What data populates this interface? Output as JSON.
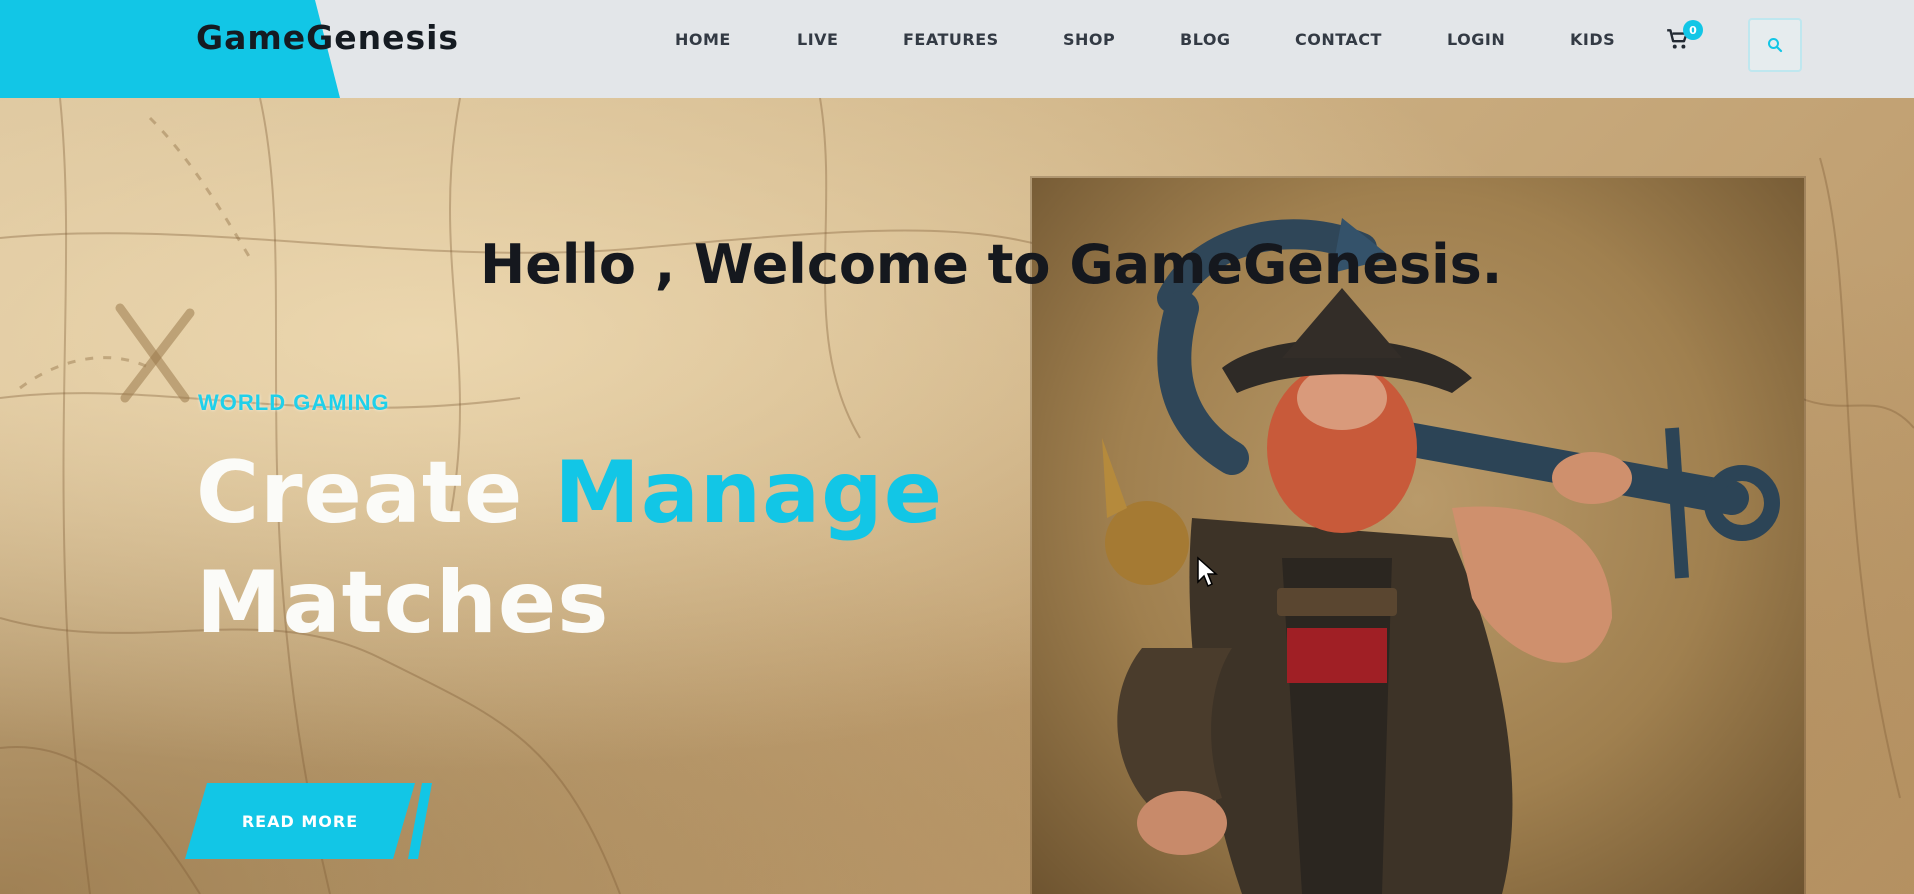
{
  "nav": {
    "brand": "GameGenesis",
    "items": [
      {
        "label": "HOME"
      },
      {
        "label": "LIVE"
      },
      {
        "label": "FEATURES"
      },
      {
        "label": "SHOP"
      },
      {
        "label": "BLOG"
      },
      {
        "label": "CONTACT"
      },
      {
        "label": "LOGIN"
      },
      {
        "label": "KIDS"
      }
    ],
    "cart_count": "0",
    "cart_icon": "shopping-cart-icon",
    "search_icon": "search-icon"
  },
  "hero": {
    "greeting": "Hello , Welcome to GameGenesis.",
    "eyebrow": "WORLD GAMING",
    "headline_word1": "Create",
    "headline_word2": "Manage",
    "headline_line2": "Matches",
    "read_more": "READ MORE",
    "image_subject": "pirate-character-with-anchor"
  },
  "colors": {
    "accent": "#12c6e6",
    "navbar_bg": "#e3e6e9",
    "brand_text": "#151b22"
  }
}
